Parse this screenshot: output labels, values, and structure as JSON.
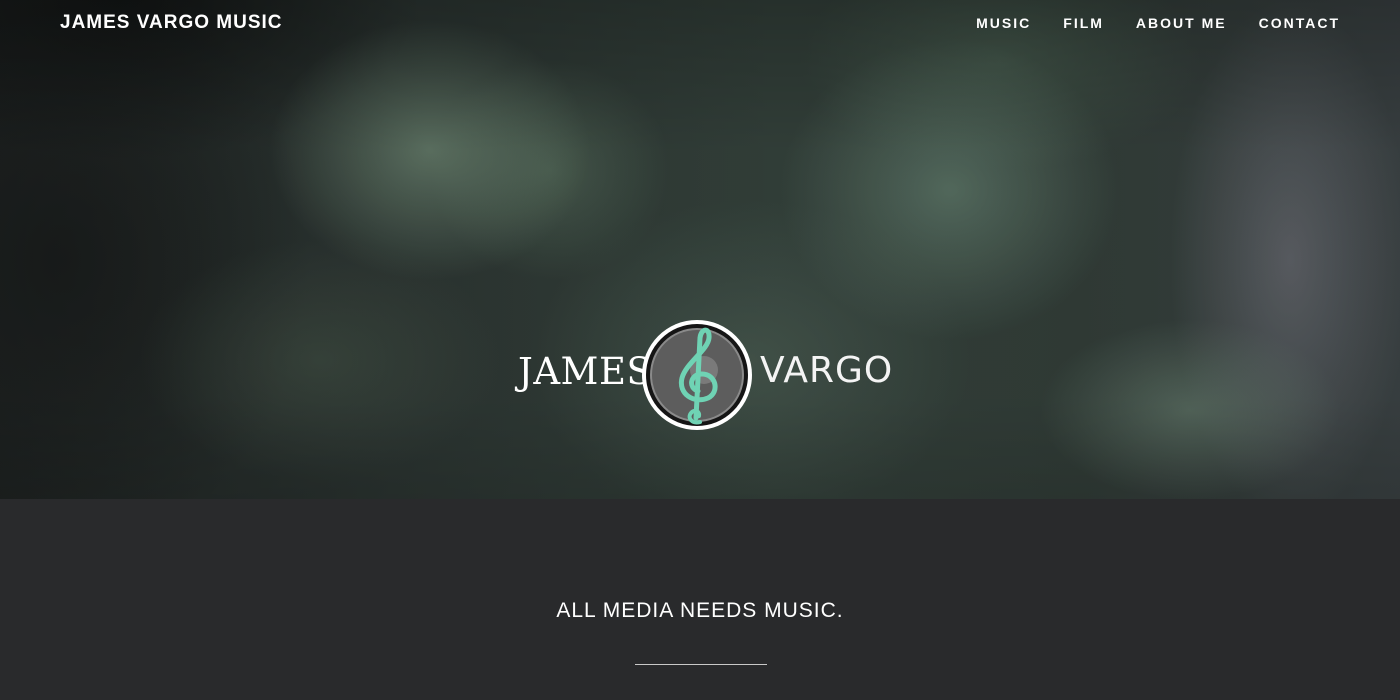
{
  "site": {
    "brand": "JAMES VARGO MUSIC"
  },
  "nav": {
    "items": [
      {
        "label": "MUSIC"
      },
      {
        "label": "FILM"
      },
      {
        "label": "ABOUT ME"
      },
      {
        "label": "CONTACT"
      }
    ]
  },
  "hero": {
    "logo": {
      "word_left": "JAMES",
      "word_right": "VARGO",
      "emblem_icon": "treble-clef-icon"
    }
  },
  "content": {
    "tagline": "ALL MEDIA NEEDS MUSIC."
  },
  "colors": {
    "accent": "#6fd3b4",
    "content_bg": "#292a2c",
    "text": "#ffffff"
  }
}
